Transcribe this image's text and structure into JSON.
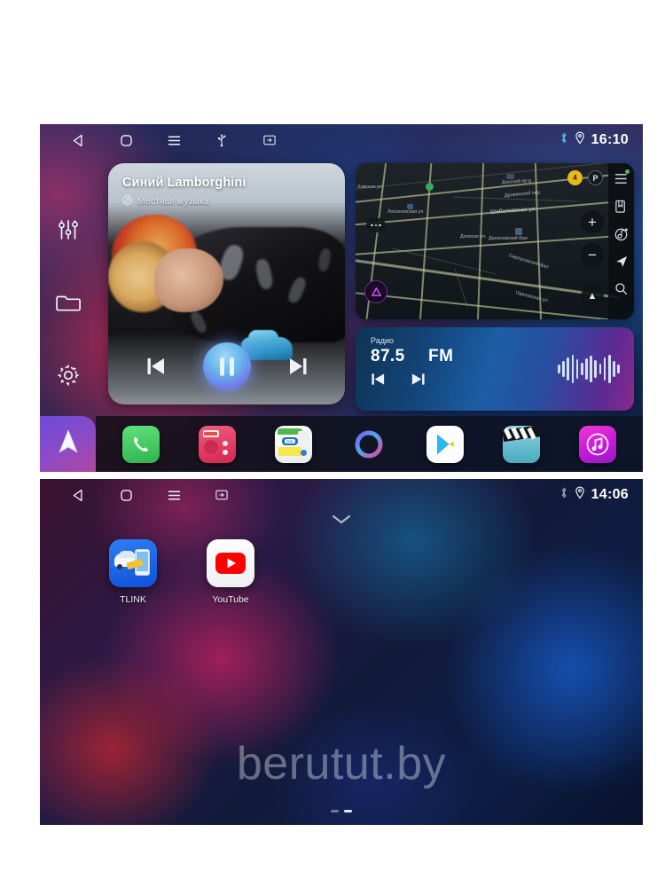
{
  "screen1": {
    "statusbar": {
      "time": "16:10",
      "icons": [
        "back-icon",
        "home-icon",
        "menu-icon",
        "usb-icon",
        "screenshot-icon"
      ],
      "right_icons": [
        "bluetooth-icon",
        "location-pin-icon"
      ]
    },
    "rail": {
      "items": [
        {
          "name": "equalizer-icon"
        },
        {
          "name": "folder-icon"
        },
        {
          "name": "settings-gear-icon"
        }
      ],
      "nav_tile": "navigation-arrow-icon"
    },
    "music": {
      "title": "Синий Lamborghini",
      "source": "Местная музыка",
      "source_badge": "music-note-badge",
      "prev_label": "prev-track",
      "play_state": "pause",
      "next_label": "next-track"
    },
    "map": {
      "traffic_level": "4",
      "parking_label": "P",
      "zoom_in": "+",
      "zoom_out": "−",
      "compass": "▲",
      "labels": [
        "Шабаловская ул.",
        "Дровянский пер.",
        "Донской пр-д",
        "Даниловский Вал",
        "Серпуховский Вал",
        "Хавская ул.",
        "Люсиновская ул.",
        "Донская ул.",
        "Павловская ул."
      ],
      "rail_icons": [
        "menu-icon",
        "bookmarks-icon",
        "music-disc-icon",
        "navigate-icon",
        "search-icon"
      ]
    },
    "radio": {
      "label": "Радио",
      "frequency": "87.5",
      "band": "FM",
      "prev_label": "seek-down",
      "next_label": "seek-up",
      "eq_bars": [
        10,
        18,
        26,
        32,
        22,
        14,
        24,
        30,
        20,
        12,
        26,
        32,
        18,
        10
      ]
    },
    "dock": {
      "apps": [
        {
          "name": "phone-app",
          "label": "Phone"
        },
        {
          "name": "radio-app",
          "label": "Radio"
        },
        {
          "name": "browser-app",
          "label": "Browser"
        },
        {
          "name": "assistant-app",
          "label": "Alice"
        },
        {
          "name": "play-store-app",
          "label": "Play Store"
        },
        {
          "name": "video-app",
          "label": "Video"
        },
        {
          "name": "music-app",
          "label": "Music"
        }
      ]
    }
  },
  "screen2": {
    "statusbar": {
      "time": "14:06",
      "icons": [
        "back-icon",
        "home-icon",
        "menu-icon",
        "screenshot-icon"
      ],
      "right_icons": [
        "bluetooth-icon",
        "location-pin-icon"
      ]
    },
    "pull_handle": "chevron-down-icon",
    "apps": [
      {
        "name": "tlink-app",
        "label": "TLINK"
      },
      {
        "name": "youtube-app",
        "label": "YouTube"
      }
    ],
    "watermark": "berutut.by",
    "pager": {
      "pages": 2,
      "active": 1
    }
  },
  "colors": {
    "accent_blue": "#69b7ee",
    "accent_purple": "#a26fe0",
    "phone_green": "#34c05a",
    "radio_pink": "#e8406a",
    "music_magenta": "#e028c8",
    "youtube_red": "#ff0000",
    "tlink_blue": "#1463e8",
    "traffic_yellow": "#e8b820"
  }
}
